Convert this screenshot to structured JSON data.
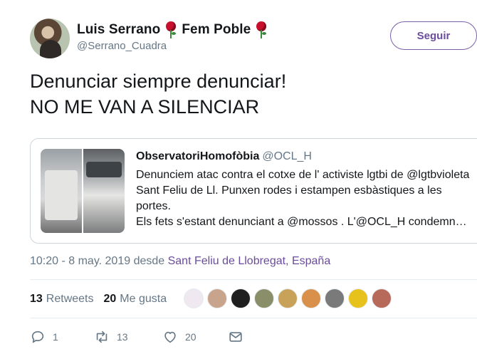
{
  "author": {
    "name": "Luis Serrano",
    "party": "Fem Poble",
    "handle": "@Serrano_Cuadra",
    "rose_icon": "rose-icon"
  },
  "follow_button": {
    "label": "Seguir"
  },
  "tweet": {
    "lines": [
      "Denunciar siempre denunciar!",
      "NO ME VAN A SILENCIAR"
    ]
  },
  "quoted": {
    "name": "ObservatoriHomofòbia",
    "handle": "@OCL_H",
    "lines": [
      "Denunciem atac contra el cotxe de l' activiste lgtbi de @lgtbvioleta",
      "Sant Feliu de Ll.  Punxen rodes i estampen esbàstiques a les",
      "portes.",
      "Els fets s'estant denunciant a @mossos . L'@OCL_H condemn…"
    ]
  },
  "meta": {
    "time": "10:20 - 8 may. 2019 desde ",
    "place": "Sant Feliu de Llobregat, España"
  },
  "stats": {
    "retweets_count": "13",
    "retweets_label": "Retweets",
    "likes_count": "20",
    "likes_label": "Me gusta",
    "liker_colors": [
      "#efe8f0",
      "#c9a48c",
      "#1f1f1f",
      "#8a8f6a",
      "#c9a25a",
      "#d9904a",
      "#7a7a7a",
      "#e8c21c",
      "#b86a5a"
    ]
  },
  "actions": {
    "reply_count": "1",
    "retweet_count": "13",
    "like_count": "20"
  },
  "colors": {
    "accent": "#6a4c9c",
    "secondary_text": "#657786"
  }
}
